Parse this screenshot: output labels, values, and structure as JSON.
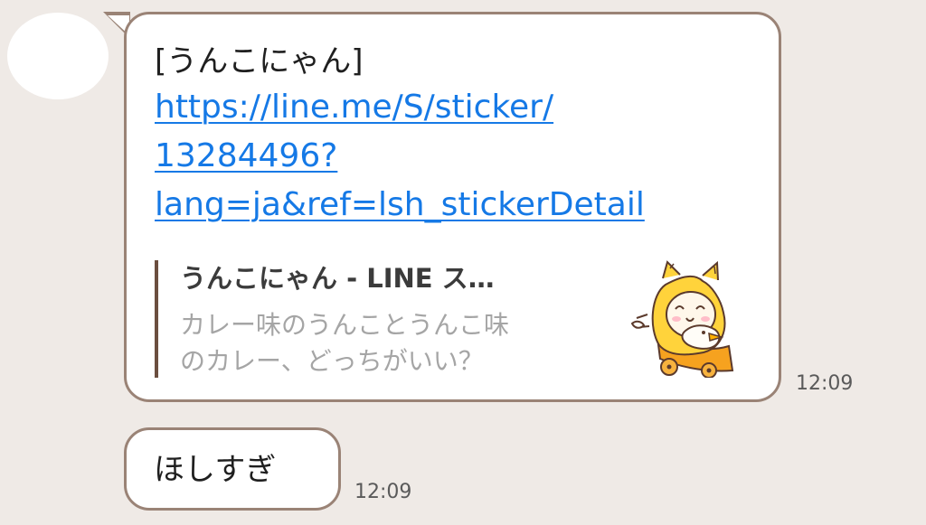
{
  "messages": [
    {
      "sticker_name": "[うんこにゃん]",
      "url_lines": [
        "https://line.me/S/sticker/",
        "13284496?",
        "lang=ja&ref=lsh_stickerDetail"
      ],
      "preview": {
        "title": "うんこにゃん - LINE ス…",
        "description_lines": [
          "カレー味のうんことうんこ味",
          "のカレー、どっちがいい？"
        ],
        "thumbnail_icon": "sticker-character-icon"
      },
      "time": "12:09"
    },
    {
      "text": "ほしすぎ",
      "time": "12:09"
    }
  ],
  "colors": {
    "background": "#efeae6",
    "bubble_border": "#9a8376",
    "link": "#1579e6",
    "preview_bar": "#6b4e3f",
    "secondary_text": "#a5a5a5"
  }
}
